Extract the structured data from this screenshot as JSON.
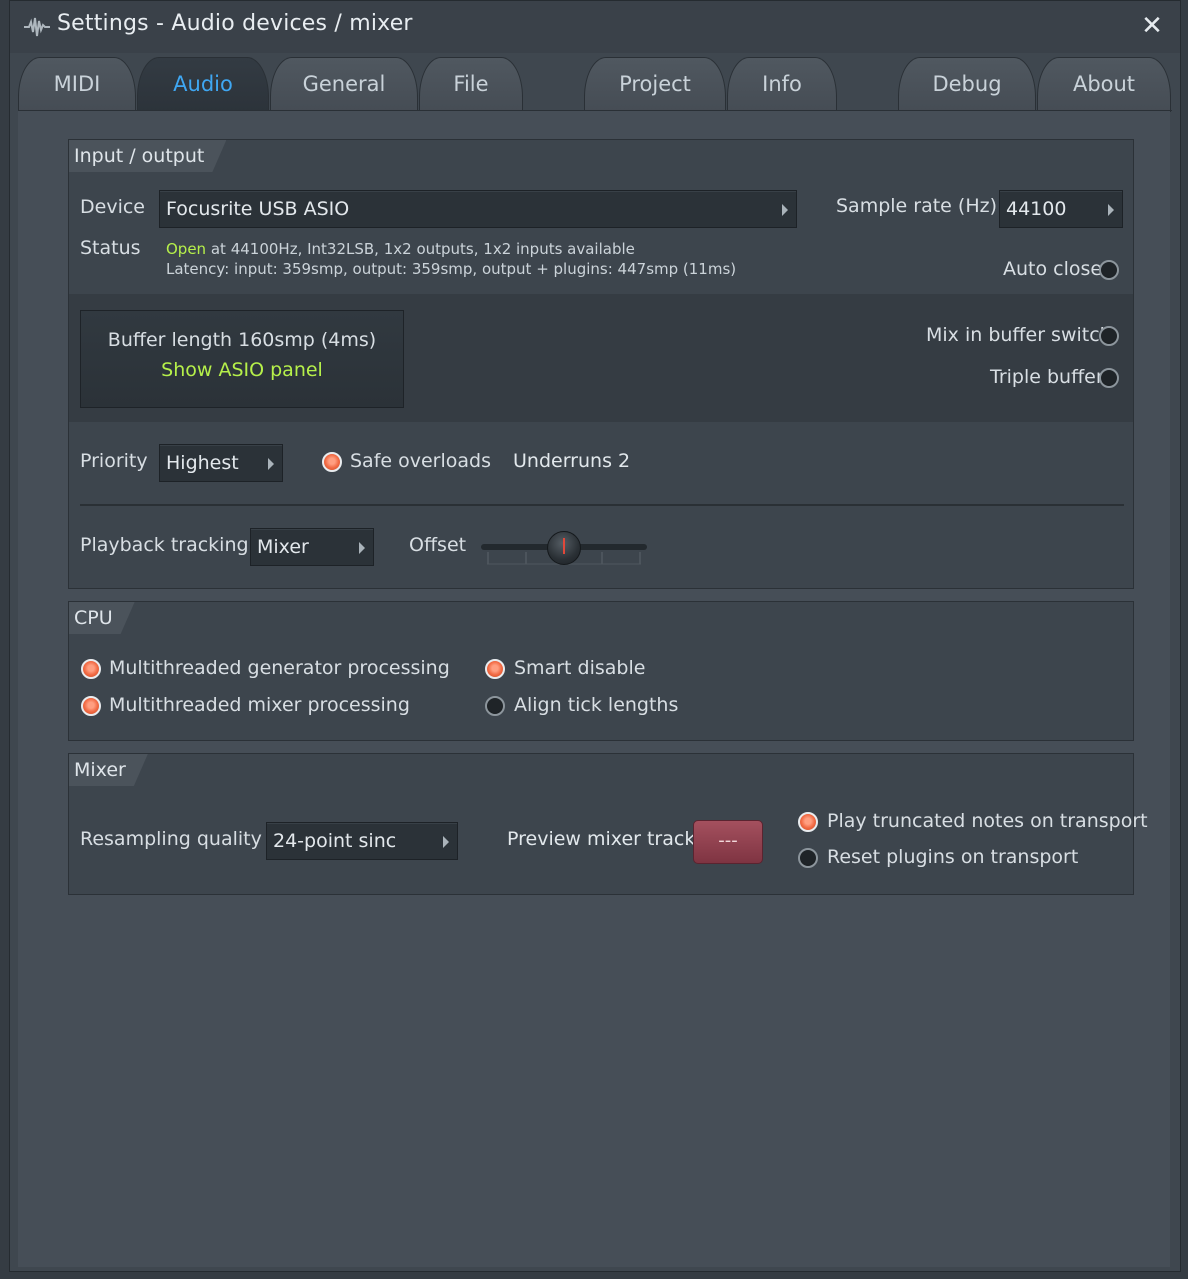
{
  "window": {
    "title": "Settings - Audio devices / mixer",
    "close_icon": "close-icon",
    "app_icon": "waveform-icon"
  },
  "tabs": [
    {
      "label": "MIDI",
      "active": false
    },
    {
      "label": "Audio",
      "active": true
    },
    {
      "label": "General",
      "active": false
    },
    {
      "label": "File",
      "active": false
    },
    {
      "label": "Project",
      "active": false
    },
    {
      "label": "Info",
      "active": false
    },
    {
      "label": "Debug",
      "active": false
    },
    {
      "label": "About",
      "active": false
    }
  ],
  "io": {
    "header": "Input / output",
    "device_label": "Device",
    "device_value": "Focusrite USB ASIO",
    "sample_rate_label": "Sample rate (Hz)",
    "sample_rate_value": "44100",
    "status_label": "Status",
    "status_open": "Open",
    "status_detail": "at 44100Hz, Int32LSB, 1x2 outputs, 1x2 inputs available",
    "latency": "Latency: input: 359smp, output: 359smp, output + plugins: 447smp (11ms)",
    "auto_close_label": "Auto close",
    "auto_close_on": false,
    "buffer_length": "Buffer length 160smp (4ms)",
    "show_asio_panel": "Show ASIO panel",
    "mix_in_buffer_switch_label": "Mix in buffer switch",
    "mix_in_buffer_switch_on": false,
    "triple_buffer_label": "Triple buffer",
    "triple_buffer_on": false,
    "priority_label": "Priority",
    "priority_value": "Highest",
    "safe_overloads_label": "Safe overloads",
    "safe_overloads_on": true,
    "underruns": "Underruns 2",
    "playback_tracking_label": "Playback tracking",
    "playback_tracking_value": "Mixer",
    "offset_label": "Offset",
    "offset_value": 0.5
  },
  "cpu": {
    "header": "CPU",
    "options": [
      {
        "label": "Multithreaded generator processing",
        "on": true
      },
      {
        "label": "Multithreaded mixer processing",
        "on": true
      },
      {
        "label": "Smart disable",
        "on": true
      },
      {
        "label": "Align tick lengths",
        "on": false
      }
    ]
  },
  "mixer": {
    "header": "Mixer",
    "resampling_label": "Resampling quality",
    "resampling_value": "24-point sinc",
    "preview_track_label": "Preview mixer track",
    "preview_track_value": "---",
    "play_truncated_label": "Play truncated notes on transport",
    "play_truncated_on": true,
    "reset_plugins_label": "Reset plugins on transport",
    "reset_plugins_on": false
  },
  "colors": {
    "accent_blue": "#3fa7f2",
    "status_green": "#b6f04a",
    "radio_on": "#f26b45",
    "preview_red": "#9a4855"
  }
}
